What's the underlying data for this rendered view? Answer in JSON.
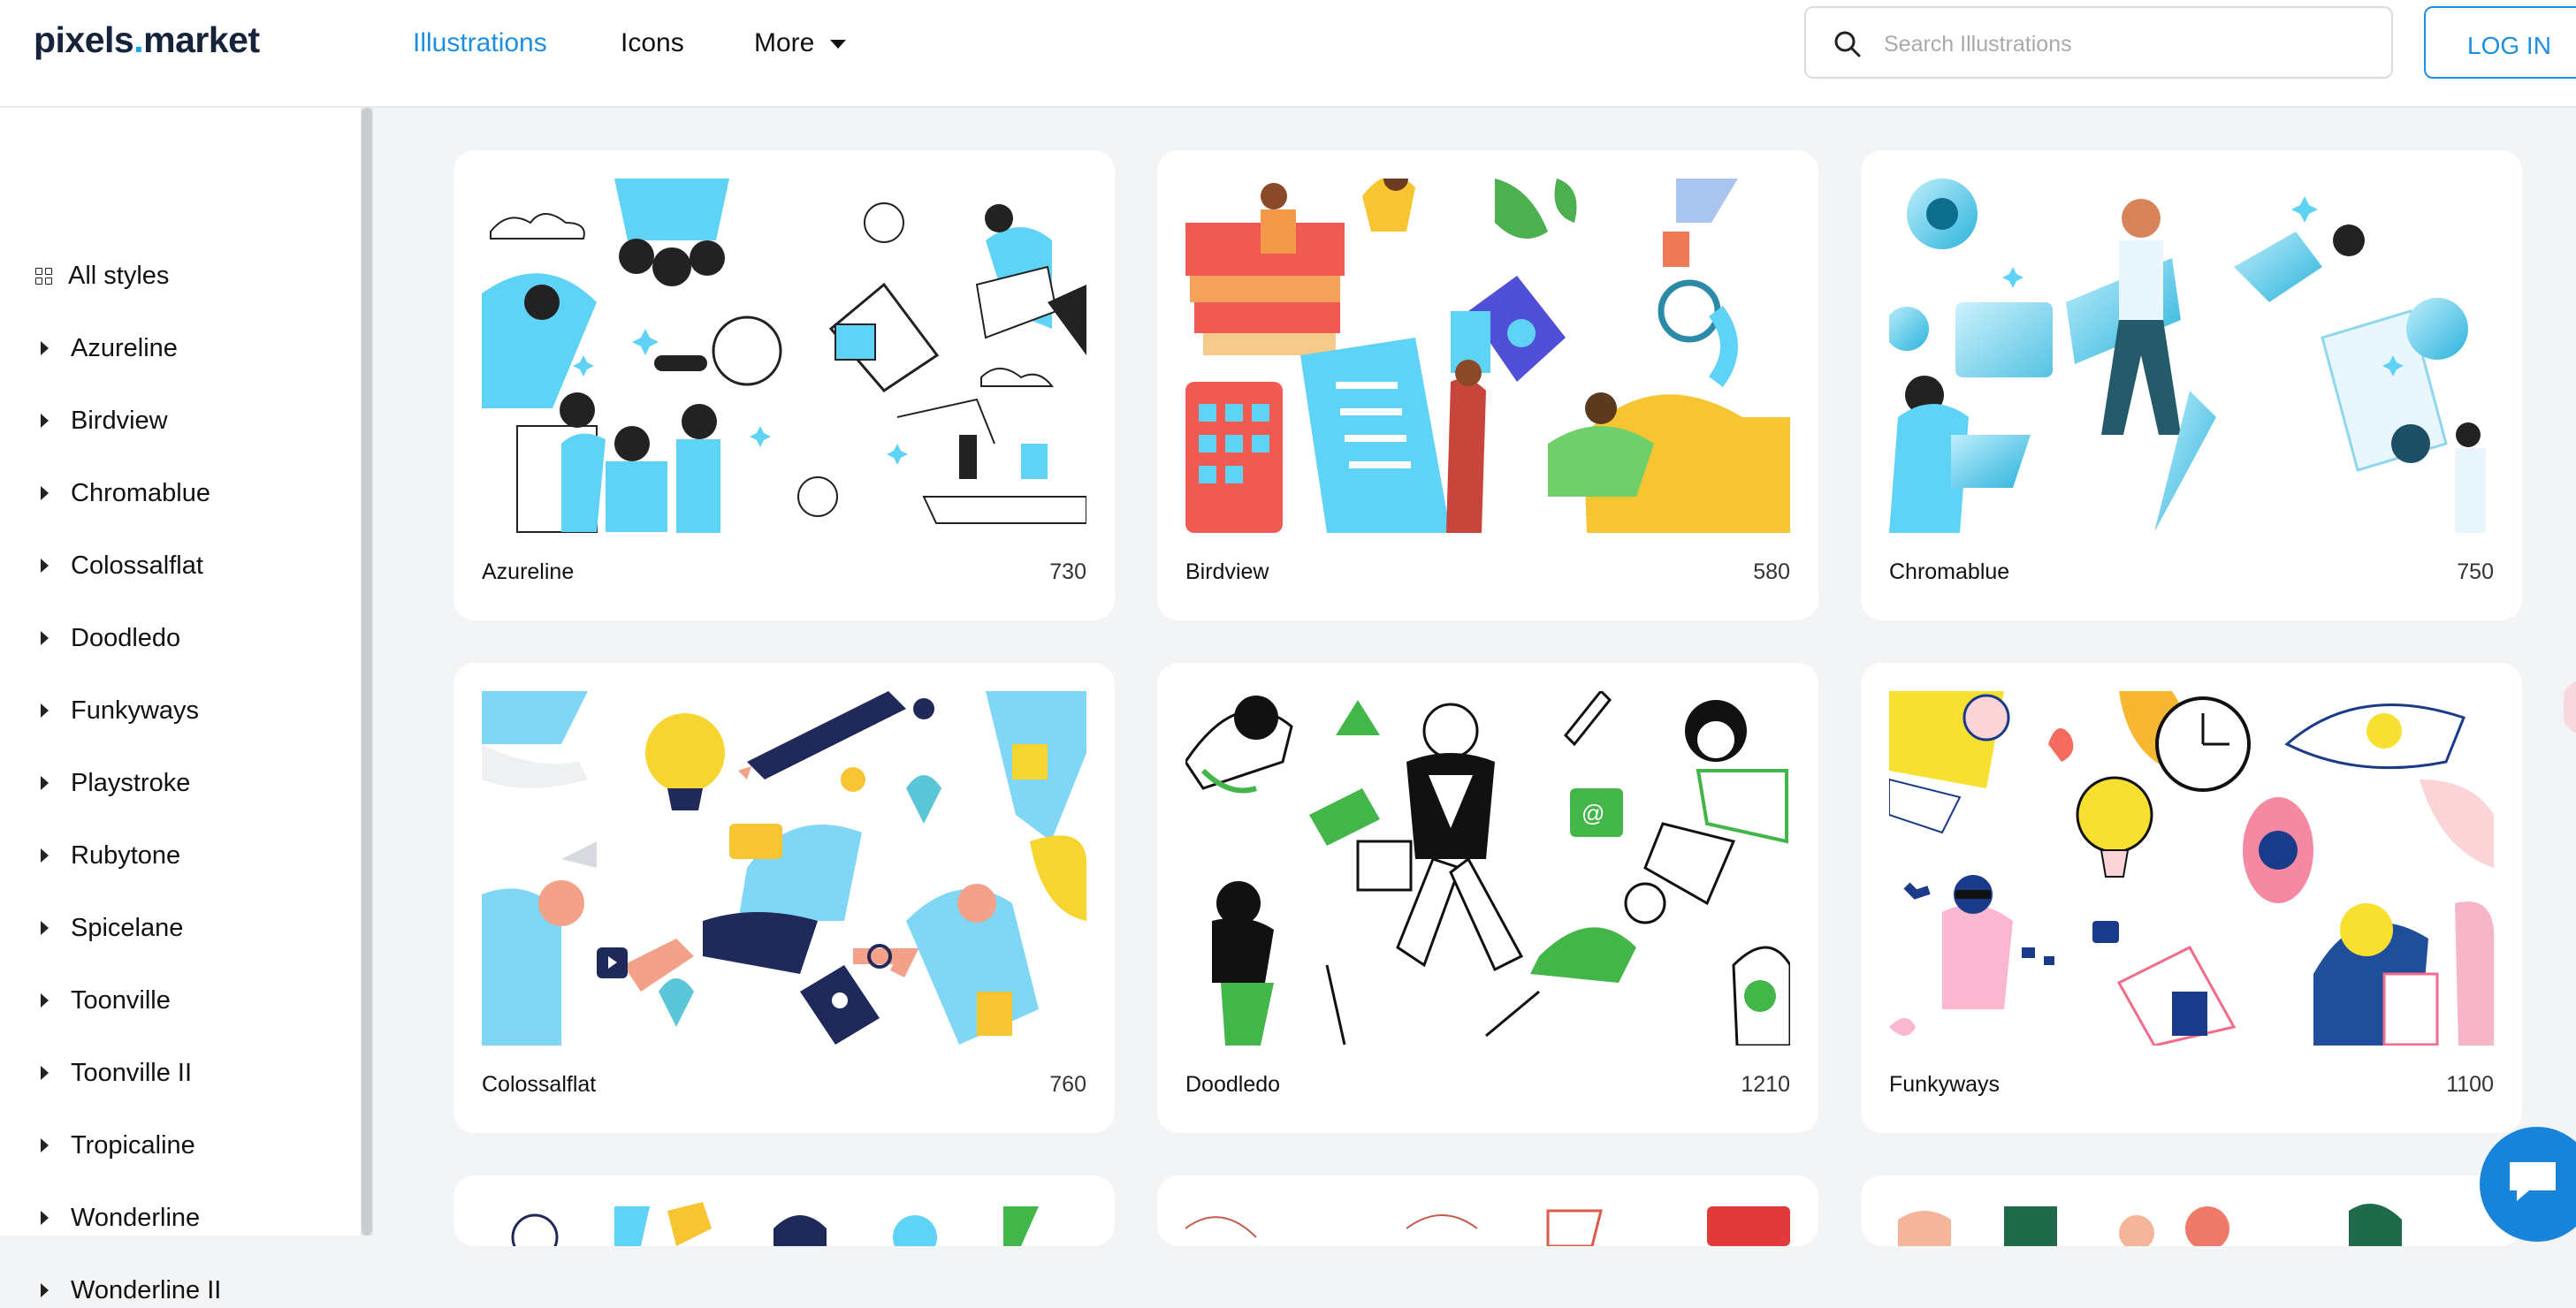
{
  "header": {
    "logo": {
      "main": "pixels",
      "dot": ".",
      "rest": "market"
    },
    "nav": {
      "illustrations": "Illustrations",
      "icons": "Icons",
      "more": "More"
    },
    "search": {
      "placeholder": "Search Illustrations"
    },
    "login_label": "LOG IN"
  },
  "sidebar": {
    "all_styles": "All styles",
    "items": [
      "Azureline",
      "Birdview",
      "Chromablue",
      "Colossalflat",
      "Doodledo",
      "Funkyways",
      "Playstroke",
      "Rubytone",
      "Spicelane",
      "Toonville",
      "Toonville II",
      "Tropicaline",
      "Wonderline",
      "Wonderline II"
    ]
  },
  "cards": [
    {
      "name": "Azureline",
      "count": "730"
    },
    {
      "name": "Birdview",
      "count": "580"
    },
    {
      "name": "Chromablue",
      "count": "750"
    },
    {
      "name": "Colossalflat",
      "count": "760"
    },
    {
      "name": "Doodledo",
      "count": "1210"
    },
    {
      "name": "Funkyways",
      "count": "1100"
    }
  ],
  "colors": {
    "accent": "#1d8fe0",
    "background": "#f3f4f6",
    "card": "#ffffff"
  }
}
